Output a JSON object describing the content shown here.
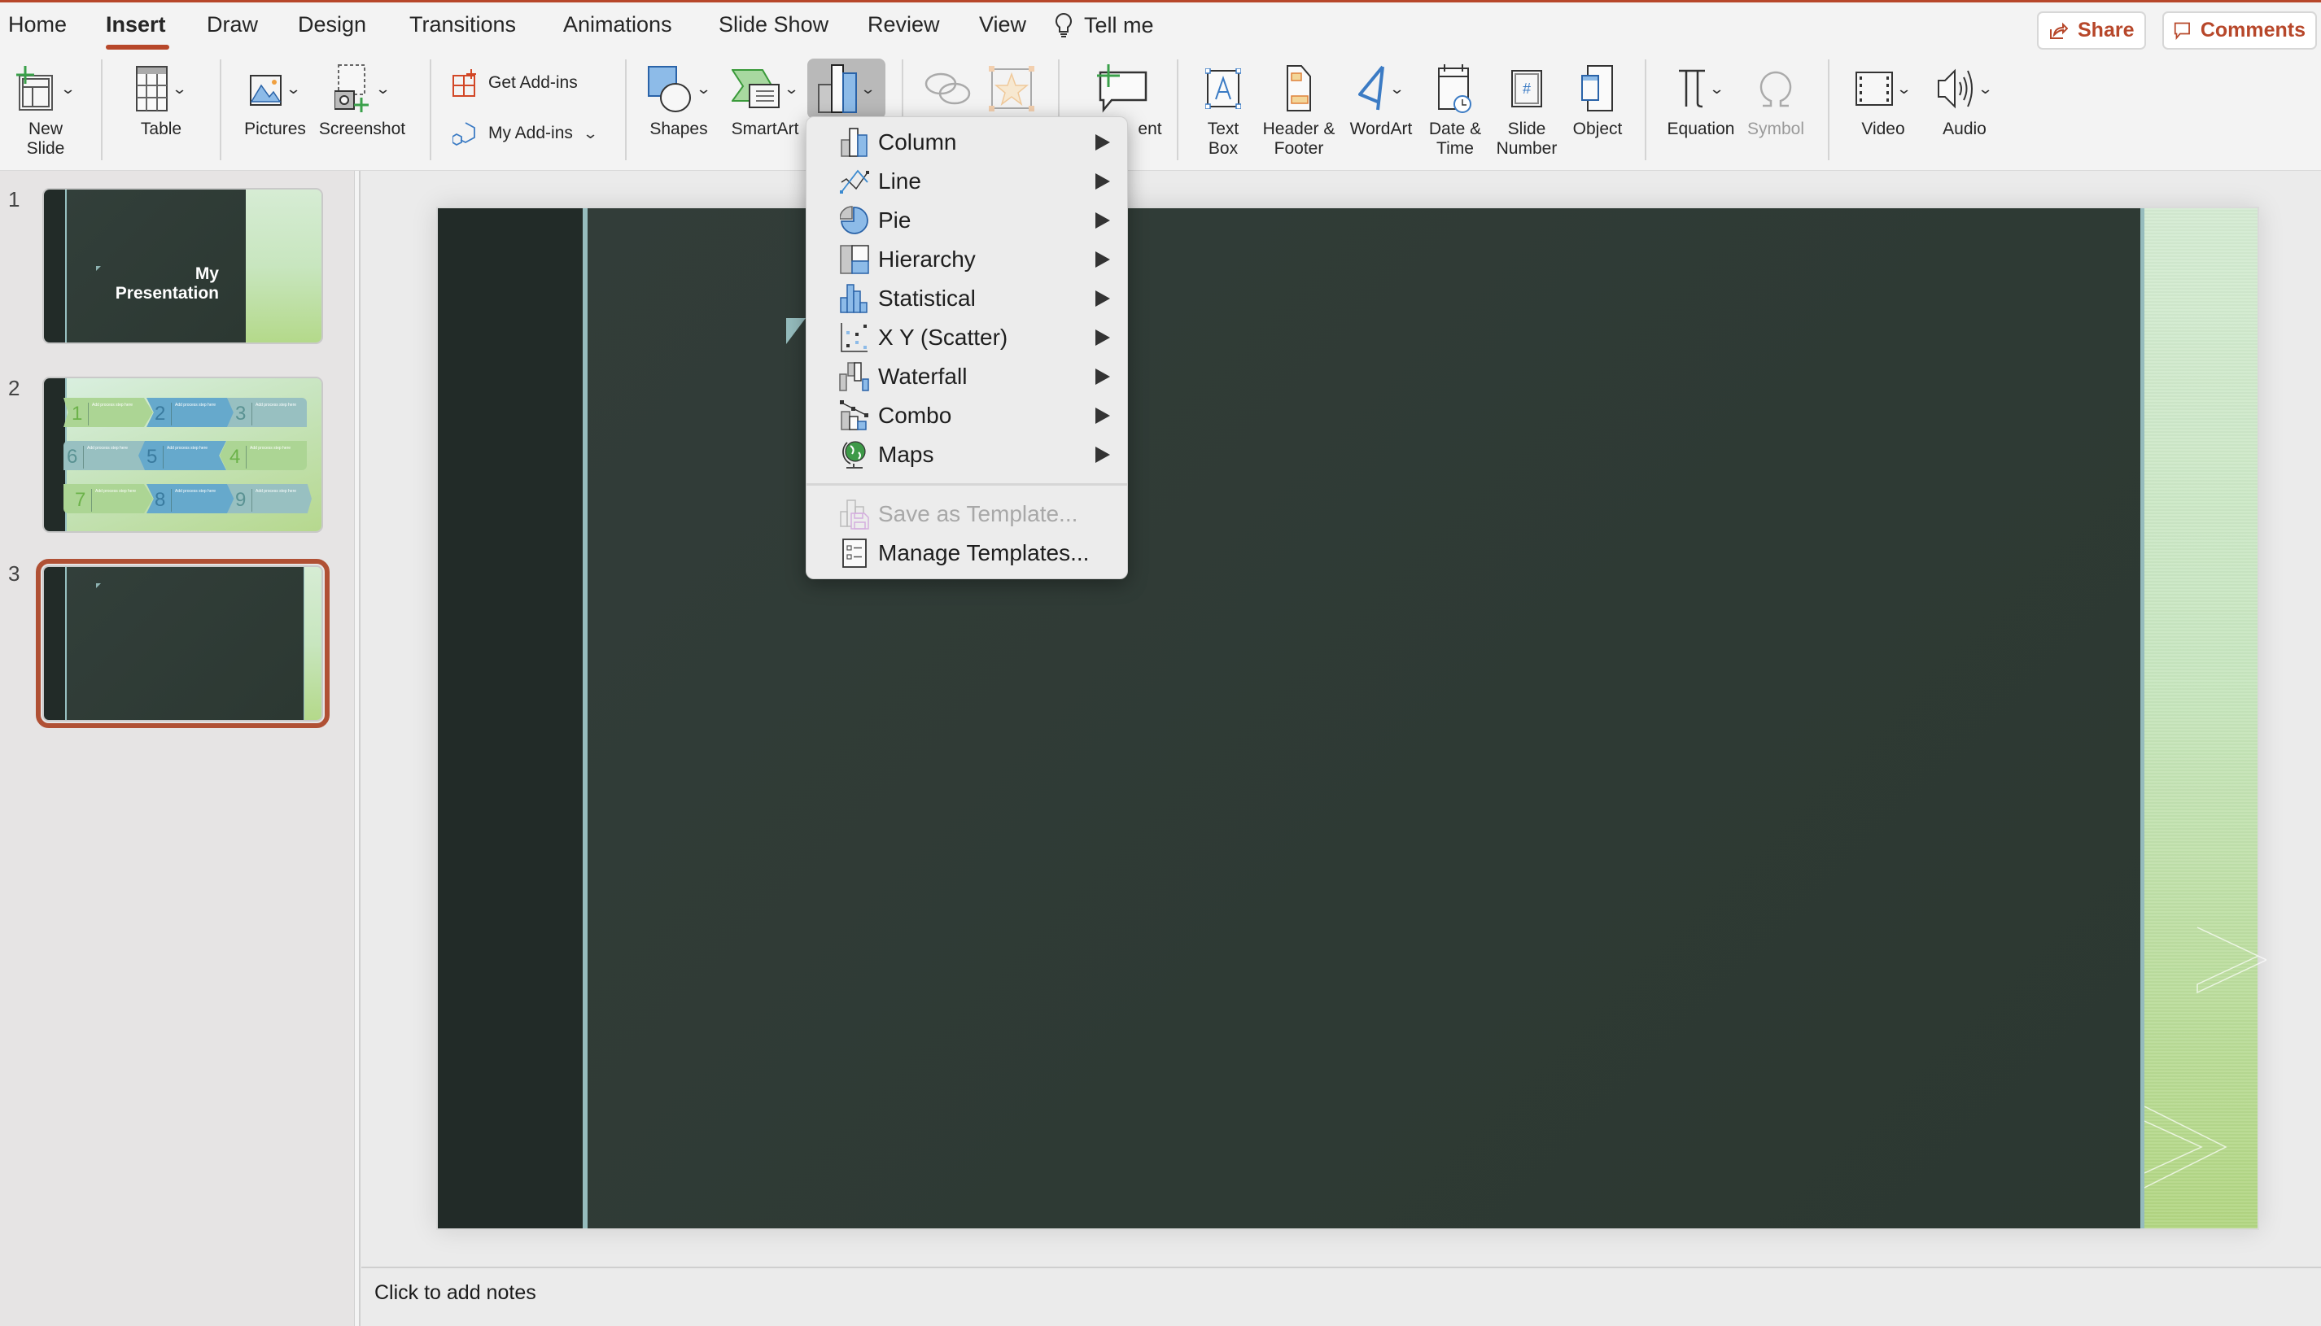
{
  "tabs": [
    {
      "label": "Home",
      "active": false
    },
    {
      "label": "Insert",
      "active": true
    },
    {
      "label": "Draw",
      "active": false
    },
    {
      "label": "Design",
      "active": false
    },
    {
      "label": "Transitions",
      "active": false
    },
    {
      "label": "Animations",
      "active": false
    },
    {
      "label": "Slide Show",
      "active": false
    },
    {
      "label": "Review",
      "active": false
    },
    {
      "label": "View",
      "active": false
    }
  ],
  "tell_me": "Tell me",
  "header_buttons": {
    "share": "Share",
    "comments": "Comments"
  },
  "accent_color": "#b7472a",
  "ribbon": {
    "new_slide": "New\nSlide",
    "table": "Table",
    "pictures": "Pictures",
    "screenshot": "Screenshot",
    "get_addins": "Get Add-ins",
    "my_addins": "My Add-ins",
    "shapes": "Shapes",
    "smartart": "SmartArt",
    "comment_partial": "ent",
    "text_box": "Text\nBox",
    "header_footer": "Header &\nFooter",
    "wordart": "WordArt",
    "date_time": "Date &\nTime",
    "slide_number": "Slide\nNumber",
    "object": "Object",
    "equation": "Equation",
    "symbol": "Symbol",
    "video": "Video",
    "audio": "Audio"
  },
  "chart_menu": {
    "items": [
      {
        "label": "Column",
        "icon": "column-chart-icon",
        "submenu": true
      },
      {
        "label": "Line",
        "icon": "line-chart-icon",
        "submenu": true
      },
      {
        "label": "Pie",
        "icon": "pie-chart-icon",
        "submenu": true
      },
      {
        "label": "Hierarchy",
        "icon": "hierarchy-chart-icon",
        "submenu": true
      },
      {
        "label": "Statistical",
        "icon": "statistical-chart-icon",
        "submenu": true
      },
      {
        "label": "X Y (Scatter)",
        "icon": "scatter-chart-icon",
        "submenu": true
      },
      {
        "label": "Waterfall",
        "icon": "waterfall-chart-icon",
        "submenu": true
      },
      {
        "label": "Combo",
        "icon": "combo-chart-icon",
        "submenu": true
      },
      {
        "label": "Maps",
        "icon": "maps-globe-icon",
        "submenu": true
      }
    ],
    "save_as_template": "Save as Template...",
    "save_as_template_enabled": false,
    "manage_templates": "Manage Templates..."
  },
  "slides": [
    {
      "number": "1",
      "title": "My\nPresentation",
      "selected": false
    },
    {
      "number": "2",
      "selected": false,
      "steps": [
        {
          "n": "1",
          "text": "Add process step here"
        },
        {
          "n": "2",
          "text": "Add process step here"
        },
        {
          "n": "3",
          "text": "Add process step here"
        },
        {
          "n": "4",
          "text": "Add process step here"
        },
        {
          "n": "5",
          "text": "Add process step here"
        },
        {
          "n": "6",
          "text": "Add process step here"
        },
        {
          "n": "7",
          "text": "Add process step here"
        },
        {
          "n": "8",
          "text": "Add process step here"
        },
        {
          "n": "9",
          "text": "Add process step here"
        }
      ]
    },
    {
      "number": "3",
      "selected": true
    }
  ],
  "notes_placeholder": "Click to add notes"
}
